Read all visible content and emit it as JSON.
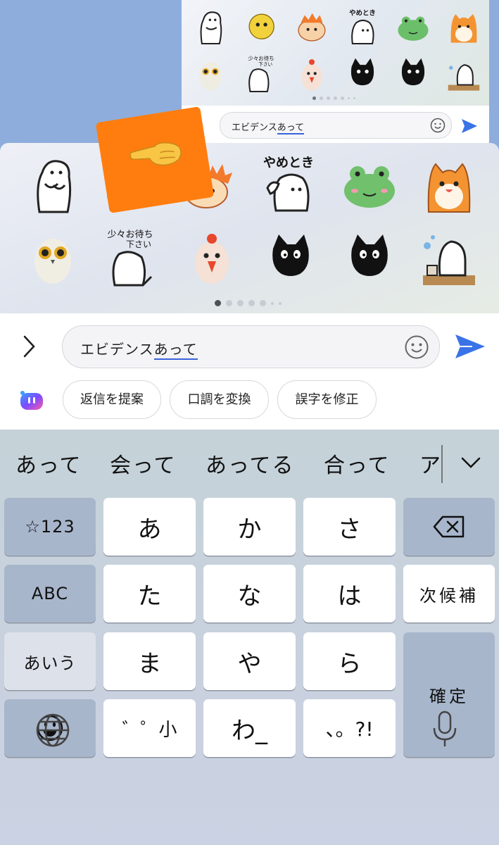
{
  "mini_screenshot": {
    "stickers": [
      "mascot-hug-icon",
      "yellow-ball-icon",
      "hamster-icon",
      "yametoki-mascot-icon",
      "frog-icon",
      "orange-hamster-icon",
      "owl-icon",
      "shoushou-omachi-mascot-icon",
      "chicken-icon",
      "black-cat-icon",
      "black-cat-icon",
      "mascot-kettle-icon"
    ],
    "input_text_plain": "エビデンス",
    "input_text_underlined": "あって"
  },
  "stickers": [
    {
      "icon": "mascot-hug-icon"
    },
    {
      "icon": "hamster-icon"
    },
    {
      "icon": "hamster-icon"
    },
    {
      "icon": "yametoki-mascot-icon",
      "text": "やめとき"
    },
    {
      "icon": "frog-icon"
    },
    {
      "icon": "orange-hamster-icon"
    },
    {
      "icon": "owl-icon"
    },
    {
      "icon": "shoushou-omachi-mascot-icon",
      "text_line1": "少々お待ち",
      "text_line2": "下さい"
    },
    {
      "icon": "chicken-icon"
    },
    {
      "icon": "black-cat-icon"
    },
    {
      "icon": "black-cat-icon"
    },
    {
      "icon": "mascot-kettle-icon"
    }
  ],
  "overlay": {
    "icon": "pointing-hand-icon",
    "color": "#ff7d0f"
  },
  "page_indicator": {
    "active": 1,
    "total": 7
  },
  "composer": {
    "text_plain": "エビデンス",
    "text_underlined": "あって",
    "icons": {
      "expand": "chevron-right-icon",
      "emoji": "smiley-icon",
      "send": "send-icon",
      "assistant": "ai-assistant-icon"
    }
  },
  "suggestions": [
    "返信を提案",
    "口調を変換",
    "誤字を修正"
  ],
  "candidates": [
    "あって",
    "会って",
    "あってる",
    "合って",
    "ア"
  ],
  "keyboard": {
    "row1": [
      "☆123",
      "あ",
      "か",
      "さ"
    ],
    "row2": [
      "ABC",
      "た",
      "な",
      "は",
      "次候補"
    ],
    "row3": [
      "あいう",
      "ま",
      "や",
      "ら",
      "確定"
    ],
    "row4": [
      "゛゜小",
      "わ_",
      "、。?!"
    ],
    "icons": {
      "backspace": "backspace-icon",
      "emoji": "emoji-face-icon",
      "globe": "globe-icon",
      "mic": "microphone-icon",
      "collapse": "chevron-down-icon"
    },
    "colors": {
      "function_key": "#a8b6cc",
      "letter_key": "#ffffff",
      "accent": "#3a63d8"
    }
  }
}
